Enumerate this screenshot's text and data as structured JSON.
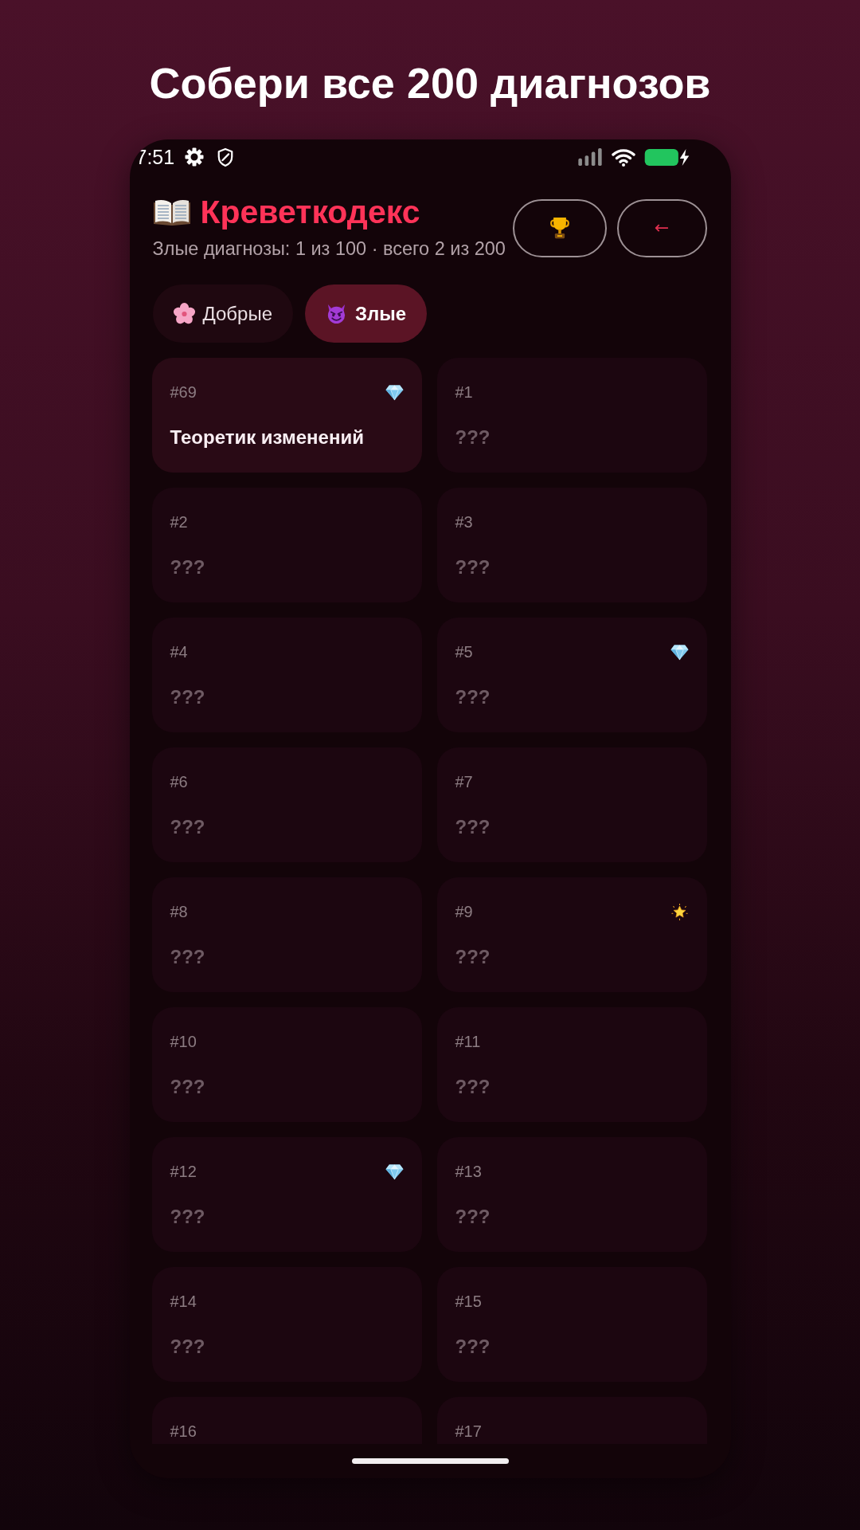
{
  "headline": "Собери все 200 диагнозов",
  "status_bar": {
    "time": "7:51"
  },
  "header": {
    "title": "Креветкодекс",
    "subtitle": "Злые диагнозы: 1 из 100 · всего 2 из 200",
    "back_button": "←"
  },
  "tabs": [
    {
      "kind": "good",
      "label": "Добрые",
      "selected": false
    },
    {
      "kind": "evil",
      "label": "Злые",
      "selected": true
    }
  ],
  "cards": [
    {
      "number": "#69",
      "name": "Теоретик изменений",
      "unlocked": true,
      "badge": {
        "kind": "gem"
      }
    },
    {
      "number": "#1",
      "name": "???",
      "unlocked": false
    },
    {
      "number": "#2",
      "name": "???",
      "unlocked": false
    },
    {
      "number": "#3",
      "name": "???",
      "unlocked": false
    },
    {
      "number": "#4",
      "name": "???",
      "unlocked": false
    },
    {
      "number": "#5",
      "name": "???",
      "unlocked": false,
      "badge": {
        "kind": "gem"
      }
    },
    {
      "number": "#6",
      "name": "???",
      "unlocked": false
    },
    {
      "number": "#7",
      "name": "???",
      "unlocked": false
    },
    {
      "number": "#8",
      "name": "???",
      "unlocked": false
    },
    {
      "number": "#9",
      "name": "???",
      "unlocked": false,
      "badge": {
        "kind": "star"
      }
    },
    {
      "number": "#10",
      "name": "???",
      "unlocked": false
    },
    {
      "number": "#11",
      "name": "???",
      "unlocked": false
    },
    {
      "number": "#12",
      "name": "???",
      "unlocked": false,
      "badge": {
        "kind": "gem"
      }
    },
    {
      "number": "#13",
      "name": "???",
      "unlocked": false
    },
    {
      "number": "#14",
      "name": "???",
      "unlocked": false
    },
    {
      "number": "#15",
      "name": "???",
      "unlocked": false
    },
    {
      "number": "#16",
      "unlocked": false
    },
    {
      "number": "#17",
      "unlocked": false
    }
  ]
}
